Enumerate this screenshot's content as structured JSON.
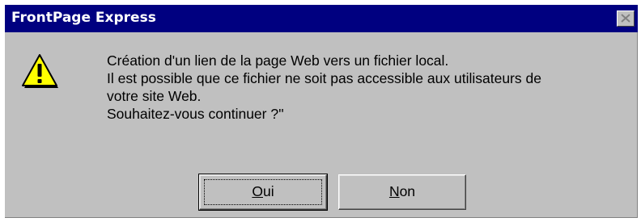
{
  "window": {
    "title": "FrontPage Express"
  },
  "icons": {
    "message_icon": "warning-icon",
    "close": "close-icon"
  },
  "message": {
    "lines": [
      "Création d'un lien de la page Web vers un fichier local.",
      "Il est possible que ce fichier ne soit pas accessible aux utilisateurs de",
      "votre site Web.",
      "Souhaitez-vous continuer ?''"
    ]
  },
  "buttons": {
    "yes": {
      "mnemonic": "O",
      "rest": "ui"
    },
    "no": {
      "mnemonic": "N",
      "rest": "on"
    }
  },
  "colors": {
    "titlebar": "#000080",
    "face": "#c0c0c0",
    "warning": "#ffff00"
  }
}
